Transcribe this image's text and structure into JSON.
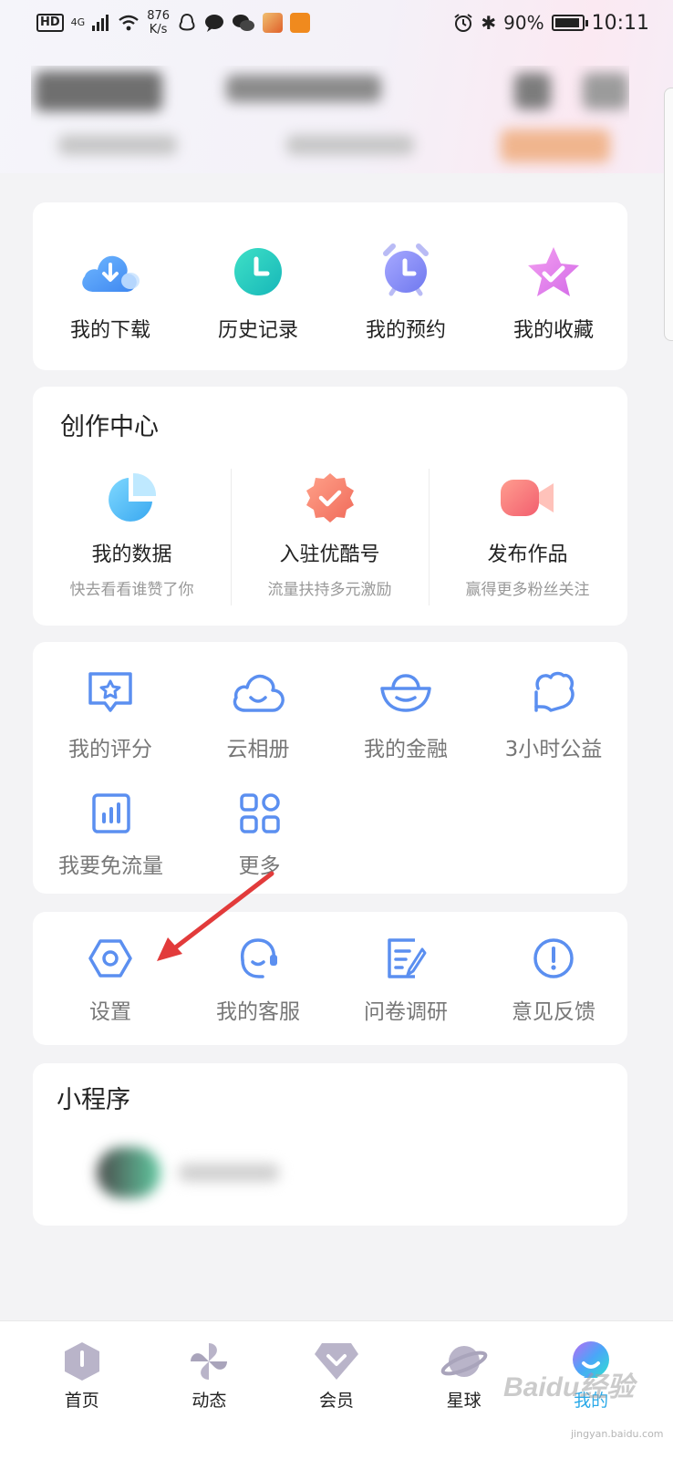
{
  "status_bar": {
    "hd": "HD",
    "network": "4G",
    "speed_value": "876",
    "speed_unit": "K/s",
    "battery": "90%",
    "time": "10:11"
  },
  "quick_actions": [
    {
      "label": "我的下载",
      "icon": "download-cloud-icon"
    },
    {
      "label": "历史记录",
      "icon": "clock-icon"
    },
    {
      "label": "我的预约",
      "icon": "alarm-clock-icon"
    },
    {
      "label": "我的收藏",
      "icon": "star-check-icon"
    }
  ],
  "creation_center": {
    "title": "创作中心",
    "items": [
      {
        "label": "我的数据",
        "sub": "快去看看谁赞了你",
        "icon": "pie-chart-icon"
      },
      {
        "label": "入驻优酷号",
        "sub": "流量扶持多元激励",
        "icon": "badge-check-icon"
      },
      {
        "label": "发布作品",
        "sub": "赢得更多粉丝关注",
        "icon": "video-camera-icon"
      }
    ]
  },
  "services": [
    {
      "label": "我的评分",
      "icon": "rating-message-icon"
    },
    {
      "label": "云相册",
      "icon": "cloud-smile-icon"
    },
    {
      "label": "我的金融",
      "icon": "gold-ingot-icon"
    },
    {
      "label": "3小时公益",
      "icon": "charity-heart-icon"
    },
    {
      "label": "我要免流量",
      "icon": "data-chart-icon"
    },
    {
      "label": "更多",
      "icon": "grid-more-icon"
    }
  ],
  "support": [
    {
      "label": "设置",
      "icon": "settings-hexagon-icon"
    },
    {
      "label": "我的客服",
      "icon": "headset-icon"
    },
    {
      "label": "问卷调研",
      "icon": "survey-edit-icon"
    },
    {
      "label": "意见反馈",
      "icon": "feedback-alert-icon"
    }
  ],
  "mini_programs": {
    "title": "小程序"
  },
  "bottom_nav": [
    {
      "label": "首页",
      "icon": "home-icon",
      "active": false
    },
    {
      "label": "动态",
      "icon": "pinwheel-icon",
      "active": false
    },
    {
      "label": "会员",
      "icon": "vip-diamond-icon",
      "active": false
    },
    {
      "label": "星球",
      "icon": "planet-icon",
      "active": false
    },
    {
      "label": "我的",
      "icon": "profile-icon",
      "active": true
    }
  ],
  "watermark": {
    "brand": "Baidu经验",
    "url": "jingyan.baidu.com"
  },
  "colors": {
    "accent": "#2aa9e8",
    "icon_blue": "#5b8ff0",
    "card_bg": "#ffffff",
    "page_bg": "#f3f3f5",
    "annotation_arrow": "#e23b3b"
  }
}
